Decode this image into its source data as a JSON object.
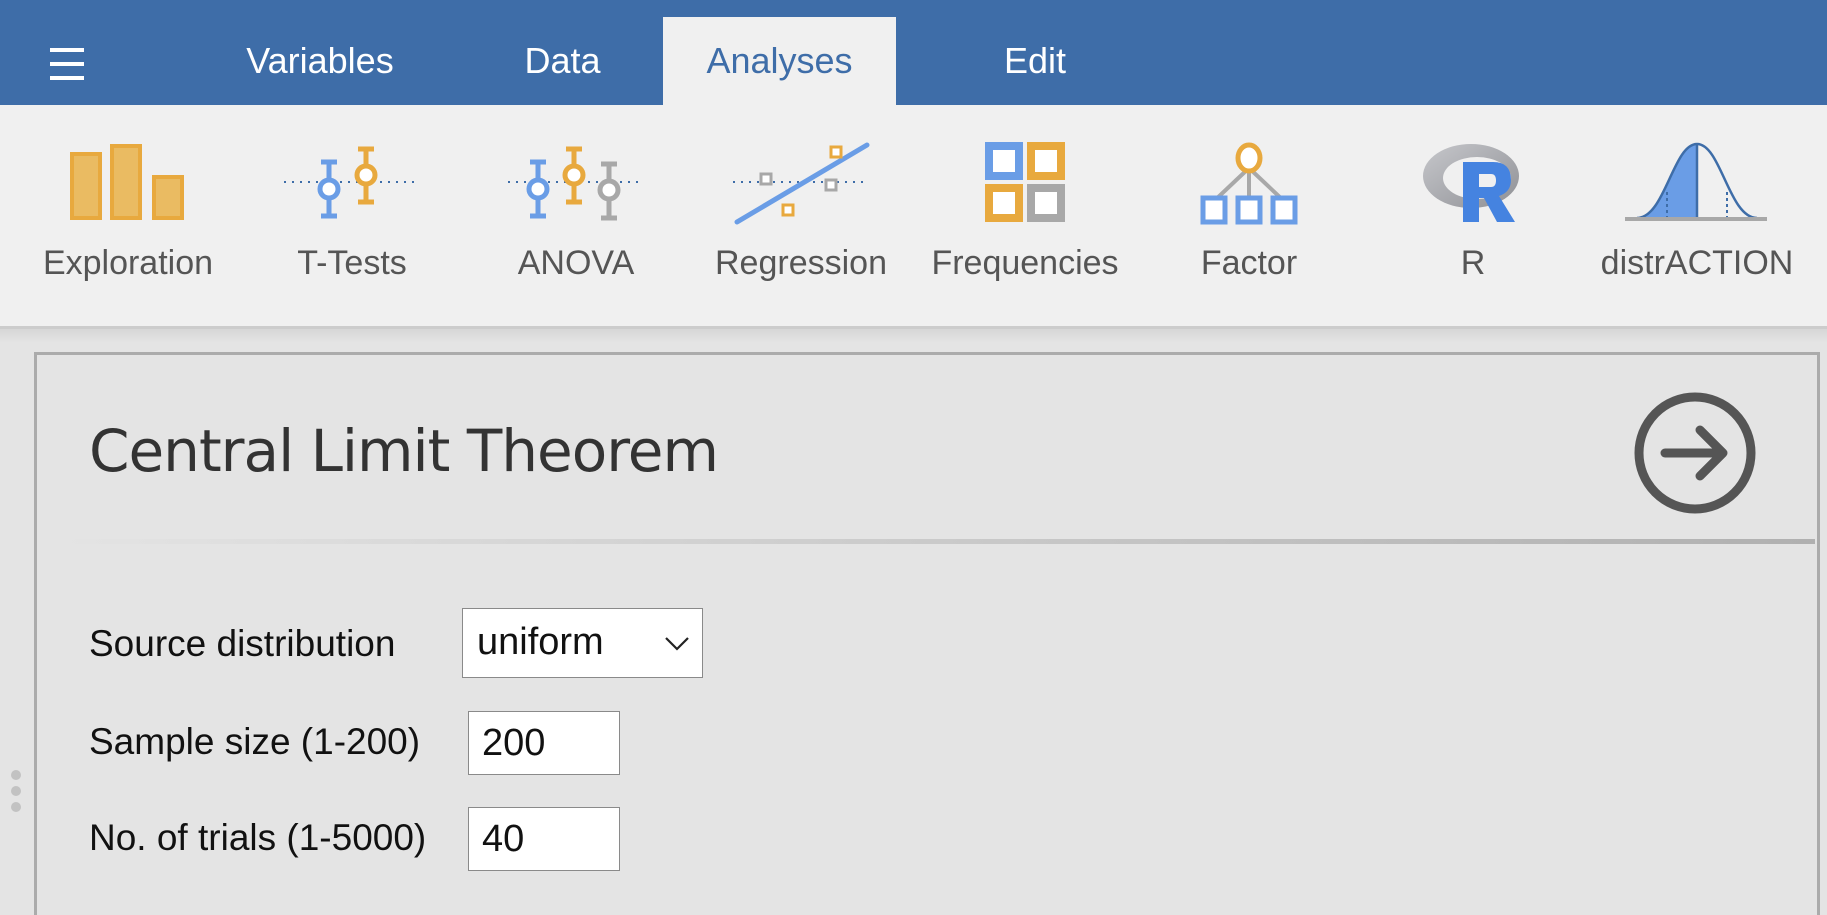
{
  "topbar": {
    "menu_icon": "hamburger-menu-icon",
    "tabs": [
      {
        "label": "Variables",
        "active": false
      },
      {
        "label": "Data",
        "active": false
      },
      {
        "label": "Analyses",
        "active": true
      },
      {
        "label": "Edit",
        "active": false
      }
    ],
    "colors": {
      "bar": "#3e6da8",
      "active_tab_bg": "#f0f0f0"
    }
  },
  "toolbar": {
    "items": [
      {
        "label": "Exploration",
        "icon": "bar-chart-icon"
      },
      {
        "label": "T-Tests",
        "icon": "t-test-icon"
      },
      {
        "label": "ANOVA",
        "icon": "anova-icon"
      },
      {
        "label": "Regression",
        "icon": "regression-icon"
      },
      {
        "label": "Frequencies",
        "icon": "frequencies-icon"
      },
      {
        "label": "Factor",
        "icon": "factor-icon"
      },
      {
        "label": "R",
        "icon": "r-logo-icon"
      },
      {
        "label": "distrACTION",
        "icon": "normal-distribution-icon"
      }
    ],
    "icon_colors": {
      "blue": "#6a9de6",
      "orange": "#e8a93e",
      "gray": "#a8a8a8"
    }
  },
  "panel": {
    "title": "Central Limit Theorem",
    "go_icon": "arrow-right-circle-icon",
    "fields": {
      "source_distribution": {
        "label": "Source distribution",
        "value": "uniform"
      },
      "sample_size": {
        "label": "Sample size (1-200)",
        "value": "200"
      },
      "trials": {
        "label": "No. of trials (1-5000)",
        "value": "40"
      }
    }
  }
}
